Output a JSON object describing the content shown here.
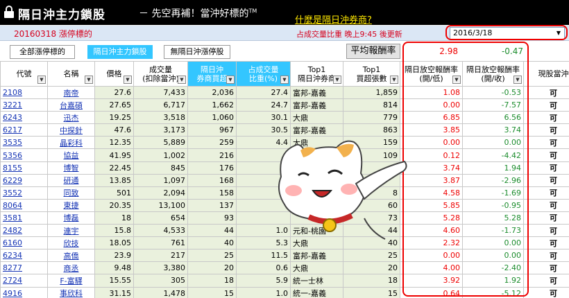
{
  "header": {
    "title": "隔日沖主力鎖股",
    "slogan": "－ 先空再補！當沖好標的",
    "tm": "TM",
    "link": "什麼是隔日沖券商?"
  },
  "info": {
    "date_label": "20160318  漲停標的",
    "update_note": "占成交量比重 晚上9:45 後更新",
    "date_selected": "2016/3/18"
  },
  "buttons": [
    "全部漲停標的",
    "隔日沖主力鎖股",
    "無隔日沖漲停股"
  ],
  "avg": {
    "label": "平均報酬率",
    "open_low": "2.98",
    "open_close": "-0.47"
  },
  "columns": [
    {
      "label": "代號",
      "filter": true
    },
    {
      "label": "名稱",
      "filter": true
    },
    {
      "label": "價格",
      "filter": true
    },
    {
      "label": "成交量\n(扣除當沖)",
      "filter": true
    },
    {
      "label": "隔日沖\n券商買超",
      "filter": true
    },
    {
      "label": "占成交量\n比重(%)",
      "filter": true
    },
    {
      "label": "Top1\n隔日沖券商",
      "filter": true
    },
    {
      "label": "Top1\n買超張數",
      "filter": true
    },
    {
      "label": "隔日放空報酬率\n(開/低)",
      "filter": true
    },
    {
      "label": "隔日放空報酬率\n(開/收)",
      "filter": true
    },
    {
      "label": "現股當沖",
      "filter": false
    }
  ],
  "rows": [
    [
      "2108",
      "南帝",
      "27.6",
      "7,433",
      "2,036",
      "27.4",
      "富邦-嘉義",
      "1,859",
      "1.08",
      "-0.53",
      "可"
    ],
    [
      "3221",
      "台嘉碩",
      "27.65",
      "6,717",
      "1,662",
      "24.7",
      "富邦-嘉義",
      "814",
      "0.00",
      "-7.57",
      "可"
    ],
    [
      "6243",
      "迅杰",
      "19.25",
      "3,518",
      "1,060",
      "30.1",
      "大鼎",
      "779",
      "6.85",
      "6.56",
      "可"
    ],
    [
      "6217",
      "中探針",
      "47.6",
      "3,173",
      "967",
      "30.5",
      "富邦-嘉義",
      "863",
      "3.85",
      "3.74",
      "可"
    ],
    [
      "3535",
      "晶彩科",
      "12.35",
      "5,889",
      "259",
      "4.4",
      "大鼎",
      "159",
      "0.00",
      "0.00",
      "可"
    ],
    [
      "5356",
      "協益",
      "41.95",
      "1,002",
      "216",
      "",
      "",
      "109",
      "0.12",
      "-4.42",
      "可"
    ],
    [
      "8155",
      "博智",
      "22.45",
      "845",
      "176",
      "",
      "",
      "",
      "3.74",
      "1.94",
      "可"
    ],
    [
      "6229",
      "研通",
      "13.85",
      "1,097",
      "168",
      "",
      "",
      "",
      "3.87",
      "-2.96",
      "可"
    ],
    [
      "3552",
      "同致",
      "501",
      "2,094",
      "158",
      "",
      "",
      "8",
      "4.58",
      "-1.69",
      "可"
    ],
    [
      "8064",
      "東捷",
      "20.35",
      "13,100",
      "137",
      "",
      "",
      "60",
      "5.85",
      "-0.95",
      "可"
    ],
    [
      "3581",
      "博磊",
      "18",
      "654",
      "93",
      "",
      "",
      "73",
      "5.28",
      "5.28",
      "可"
    ],
    [
      "2482",
      "連宇",
      "15.8",
      "4,533",
      "44",
      "1.0",
      "元和-桃園",
      "44",
      "4.60",
      "-1.73",
      "可"
    ],
    [
      "6160",
      "欣技",
      "18.05",
      "761",
      "40",
      "5.3",
      "大鼎",
      "40",
      "2.32",
      "0.00",
      "可"
    ],
    [
      "6234",
      "高僑",
      "23.9",
      "217",
      "25",
      "11.5",
      "富邦-嘉義",
      "25",
      "0.00",
      "0.00",
      "可"
    ],
    [
      "8277",
      "商丞",
      "9.48",
      "3,380",
      "20",
      "0.6",
      "大鼎",
      "20",
      "4.00",
      "-2.40",
      "可"
    ],
    [
      "2724",
      "F-富驛",
      "15.55",
      "305",
      "18",
      "5.9",
      "統一士林",
      "18",
      "3.92",
      "1.92",
      "可"
    ],
    [
      "4916",
      "事欣科",
      "31.15",
      "1,478",
      "15",
      "1.0",
      "統一-嘉義",
      "15",
      "0.64",
      "-5.12",
      "可"
    ]
  ],
  "colors": {
    "accent": "#33c6ff",
    "negative_red": "#ee0000",
    "positive_green": "#1b8c2c",
    "link_yellow": "#ffe800"
  },
  "icons": [
    "lock-icon",
    "dropdown-caret-icon",
    "filter-icon",
    "lucky-cat-illustration"
  ]
}
